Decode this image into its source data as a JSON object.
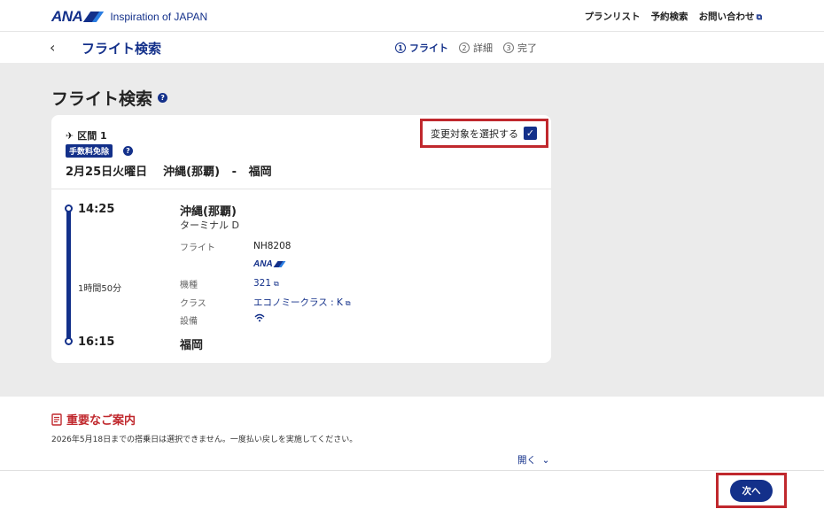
{
  "header": {
    "brand": "ANA",
    "tagline": "Inspiration of JAPAN",
    "nav": [
      "プランリスト",
      "予約検索",
      "お問い合わせ"
    ]
  },
  "subheader": {
    "back_icon": "chevron-left-icon",
    "title": "フライト検索",
    "steps": [
      {
        "num": "1",
        "label": "フライト",
        "active": true
      },
      {
        "num": "2",
        "label": "詳細",
        "active": false
      },
      {
        "num": "3",
        "label": "完了",
        "active": false
      }
    ]
  },
  "main": {
    "heading": "フライト検索",
    "segment": {
      "label": "区間 1",
      "fee_badge": "手数料免除",
      "date": "2月25日火曜日",
      "from": "沖縄(那覇)",
      "sep": "-",
      "to": "福岡",
      "select_label": "変更対象を選択する",
      "selected": true
    },
    "flight": {
      "dep_time": "14:25",
      "arr_time": "16:15",
      "duration": "1時間50分",
      "dep_city": "沖縄(那覇)",
      "terminal": "ターミナル D",
      "arr_city": "福岡",
      "flight_label": "フライト",
      "flight_no": "NH8208",
      "carrier": "ANA",
      "aircraft_label": "機種",
      "aircraft": "321",
      "class_label": "クラス",
      "class": "エコノミークラス : K",
      "equipment_label": "設備",
      "equipment_icon": "wifi-icon"
    }
  },
  "notice": {
    "title": "重要なご案内",
    "text": "2026年5月18日までの搭乗日は選択できません。一度払い戻しを実施してください。",
    "open_label": "開く"
  },
  "footer": {
    "next_label": "次へ"
  },
  "colors": {
    "brand": "#13308a",
    "highlight": "#c0282d",
    "background": "#ebebeb"
  }
}
